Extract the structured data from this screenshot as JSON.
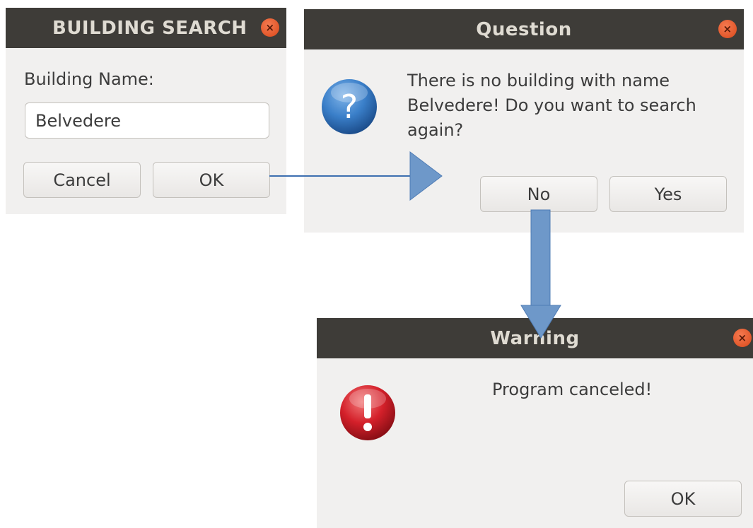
{
  "search_dialog": {
    "title": "BUILDING SEARCH",
    "close_glyph": "×",
    "field_label": "Building Name:",
    "field_value": "Belvedere",
    "cancel_label": "Cancel",
    "ok_label": "OK"
  },
  "question_dialog": {
    "title": "Question",
    "close_glyph": "×",
    "icon": "question-icon",
    "message_lines": [
      "There is no building with name",
      "Belvedere! Do you want to search",
      "again?"
    ],
    "no_label": "No",
    "yes_label": "Yes"
  },
  "warning_dialog": {
    "title": "Warning",
    "close_glyph": "×",
    "icon": "error-icon",
    "message": "Program canceled!",
    "ok_label": "OK"
  },
  "colors": {
    "titlebar": "#3e3c38",
    "dialog_body": "#f1f0ef",
    "close_button": "#e6561e",
    "arrow": "#6e98c9",
    "question_icon": "#2f6fb6",
    "error_icon": "#d4202a"
  }
}
